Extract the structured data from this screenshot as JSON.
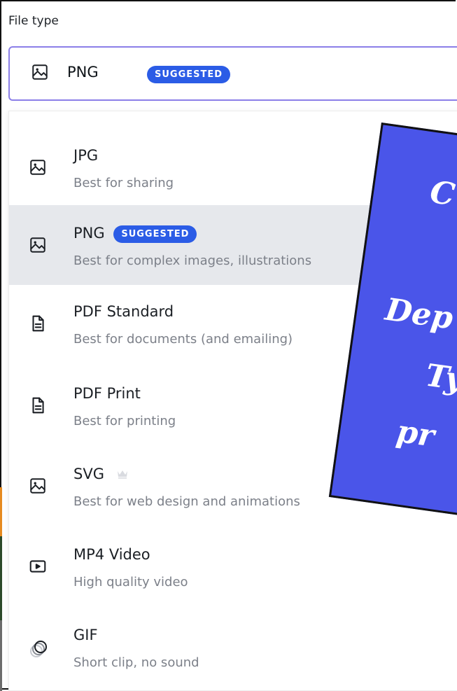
{
  "field": {
    "label": "File type"
  },
  "selected": {
    "name": "PNG",
    "badge": "SUGGESTED"
  },
  "options": [
    {
      "name": "JPG",
      "description": "Best for sharing",
      "icon": "image-icon"
    },
    {
      "name": "PNG",
      "badge": "SUGGESTED",
      "description": "Best for complex images, illustrations",
      "icon": "image-icon",
      "active": true
    },
    {
      "name": "PDF Standard",
      "description": "Best for documents (and emailing)",
      "icon": "document-icon"
    },
    {
      "name": "PDF Print",
      "description": "Best for printing",
      "icon": "document-icon"
    },
    {
      "name": "SVG",
      "description": "Best for web design and animations",
      "icon": "image-icon",
      "premium_icon": "crown-icon"
    },
    {
      "name": "MP4 Video",
      "description": "High quality video",
      "icon": "video-icon"
    },
    {
      "name": "GIF",
      "description": "Short clip, no sound",
      "icon": "gif-icon"
    }
  ],
  "overlay": {
    "lines": [
      "C",
      "Dep",
      "Ty",
      "pr"
    ]
  },
  "colors": {
    "accent": "#2b5ce6",
    "focus_border": "#8b7fe8",
    "active_row": "#e6e8ec",
    "overlay": "#4a55e9"
  }
}
